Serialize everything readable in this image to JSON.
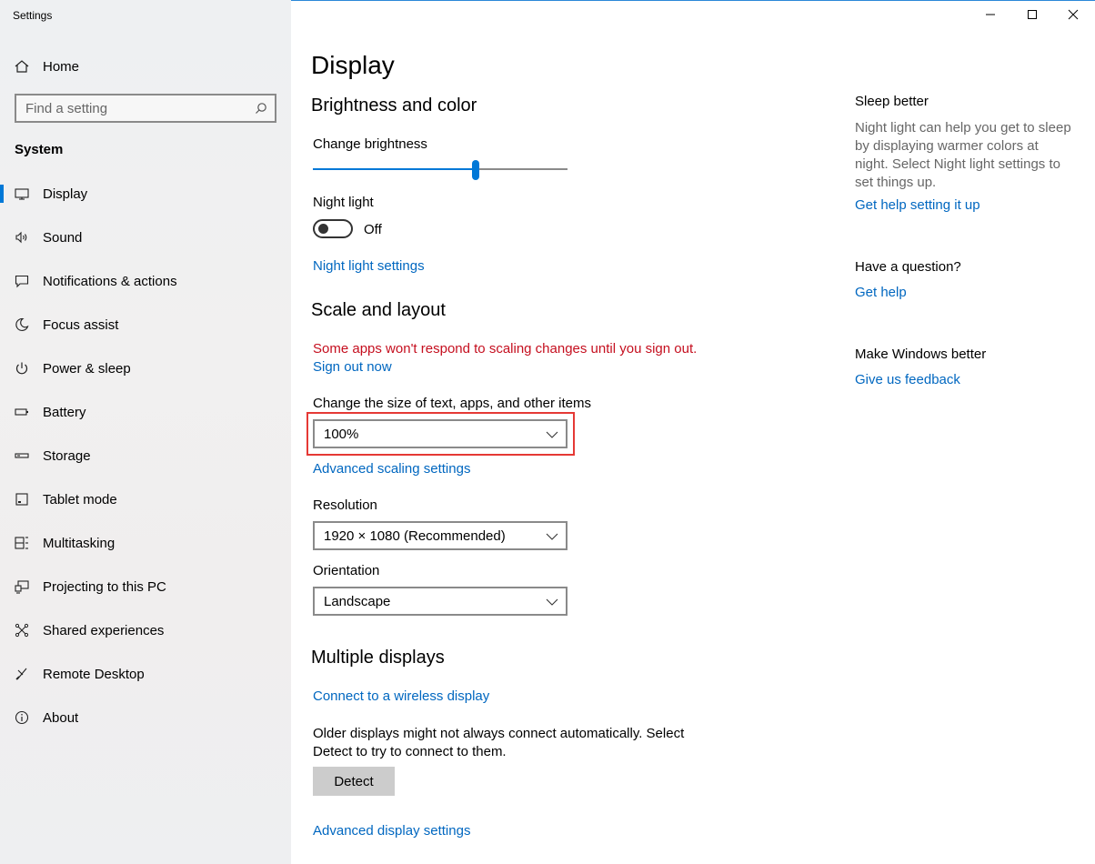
{
  "window": {
    "title": "Settings"
  },
  "sidebar": {
    "home_label": "Home",
    "search_placeholder": "Find a setting",
    "section": "System",
    "items": [
      {
        "label": "Display",
        "icon": "monitor-icon",
        "active": true
      },
      {
        "label": "Sound",
        "icon": "speaker-icon"
      },
      {
        "label": "Notifications & actions",
        "icon": "notification-icon"
      },
      {
        "label": "Focus assist",
        "icon": "moon-icon"
      },
      {
        "label": "Power & sleep",
        "icon": "power-icon"
      },
      {
        "label": "Battery",
        "icon": "battery-icon"
      },
      {
        "label": "Storage",
        "icon": "storage-icon"
      },
      {
        "label": "Tablet mode",
        "icon": "tablet-icon"
      },
      {
        "label": "Multitasking",
        "icon": "multitasking-icon"
      },
      {
        "label": "Projecting to this PC",
        "icon": "projecting-icon"
      },
      {
        "label": "Shared experiences",
        "icon": "shared-icon"
      },
      {
        "label": "Remote Desktop",
        "icon": "remote-icon"
      },
      {
        "label": "About",
        "icon": "info-icon"
      }
    ]
  },
  "main": {
    "title": "Display",
    "brightness": {
      "heading": "Brightness and color",
      "label": "Change brightness",
      "value_fraction": 0.64
    },
    "night_light": {
      "label": "Night light",
      "state": "Off",
      "settings_link": "Night light settings"
    },
    "scale": {
      "heading": "Scale and layout",
      "warning": "Some apps won't respond to scaling changes until you sign out.",
      "sign_out_link": "Sign out now",
      "size_label": "Change the size of text, apps, and other items",
      "size_value": "100%",
      "advanced_link": "Advanced scaling settings",
      "resolution_label": "Resolution",
      "resolution_value": "1920 × 1080 (Recommended)",
      "orientation_label": "Orientation",
      "orientation_value": "Landscape"
    },
    "multiple": {
      "heading": "Multiple displays",
      "wireless_link": "Connect to a wireless display",
      "description": "Older displays might not always connect automatically. Select Detect to try to connect to them.",
      "detect_button": "Detect",
      "advanced_link": "Advanced display settings"
    }
  },
  "right": {
    "sleep_heading": "Sleep better",
    "sleep_text": "Night light can help you get to sleep by displaying warmer colors at night. Select Night light settings to set things up.",
    "sleep_link": "Get help setting it up",
    "question_heading": "Have a question?",
    "question_link": "Get help",
    "feedback_heading": "Make Windows better",
    "feedback_link": "Give us feedback"
  },
  "colors": {
    "accent": "#0078d7",
    "link": "#0067c0",
    "warning": "#c50f1f",
    "highlight": "#e53935"
  }
}
